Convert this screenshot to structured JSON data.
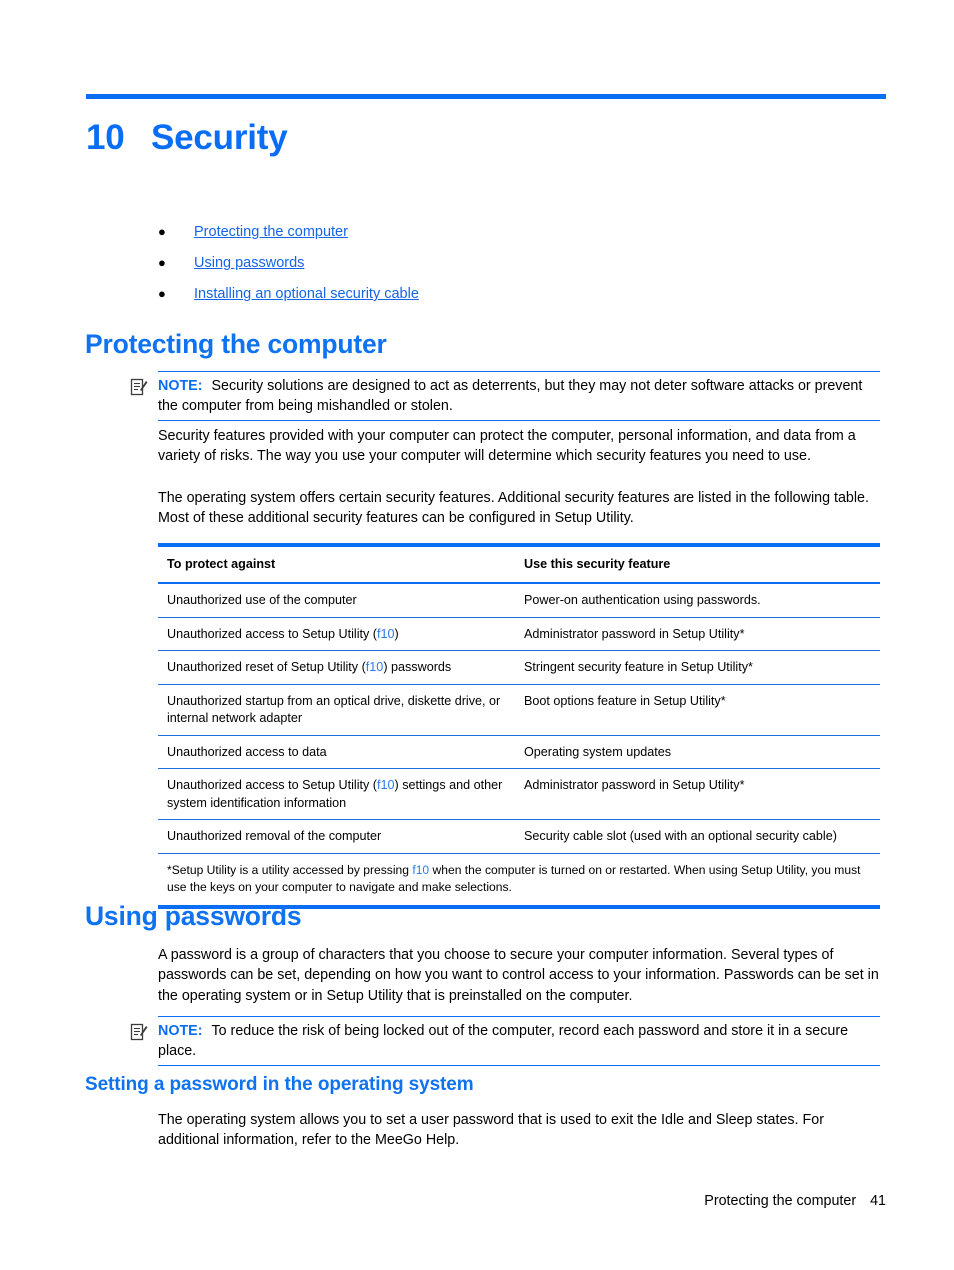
{
  "chapter": {
    "number": "10",
    "title": "Security"
  },
  "toc": {
    "items": [
      {
        "label": "Protecting the computer"
      },
      {
        "label": "Using passwords"
      },
      {
        "label": "Installing an optional security cable"
      }
    ]
  },
  "sections": {
    "protecting": {
      "heading": "Protecting the computer",
      "note": {
        "label": "NOTE:",
        "text": "Security solutions are designed to act as deterrents, but they may not deter software attacks or prevent the computer from being mishandled or stolen."
      },
      "paragraph1": "Security features provided with your computer can protect the computer, personal information, and data from a variety of risks. The way you use your computer will determine which security features you need to use.",
      "paragraph2": "The operating system offers certain security features. Additional security features are listed in the following table. Most of these additional security features can be configured in Setup Utility."
    },
    "passwords": {
      "heading": "Using passwords",
      "paragraph1": "A password is a group of characters that you choose to secure your computer information. Several types of passwords can be set, depending on how you want to control access to your information. Passwords can be set in the operating system or in Setup Utility that is preinstalled on the computer.",
      "note": {
        "label": "NOTE:",
        "text": "To reduce the risk of being locked out of the computer, record each password and store it in a secure place."
      }
    },
    "setting_password": {
      "heading": "Setting a password in the operating system",
      "paragraph1": "The operating system allows you to set a user password that is used to exit the Idle and Sleep states. For additional information, refer to the MeeGo Help."
    }
  },
  "table": {
    "headers": {
      "col_a": "To protect against",
      "col_b": "Use this security feature"
    },
    "rows": [
      {
        "a_pre": "Unauthorized use of the computer",
        "a_key": "",
        "a_post": "",
        "b": "Power-on authentication using passwords."
      },
      {
        "a_pre": "Unauthorized access to Setup Utility (",
        "a_key": "f10",
        "a_post": ")",
        "b": "Administrator password in Setup Utility*"
      },
      {
        "a_pre": "Unauthorized reset of Setup Utility (",
        "a_key": "f10",
        "a_post": ") passwords",
        "b": "Stringent security feature in Setup Utility*"
      },
      {
        "a_pre": "Unauthorized startup from an optical drive, diskette drive, or internal network adapter",
        "a_key": "",
        "a_post": "",
        "b": "Boot options feature in Setup Utility*"
      },
      {
        "a_pre": "Unauthorized access to data",
        "a_key": "",
        "a_post": "",
        "b": "Operating system updates"
      },
      {
        "a_pre": "Unauthorized access to Setup Utility (",
        "a_key": "f10",
        "a_post": ") settings and other system identification information",
        "b": "Administrator password in Setup Utility*"
      },
      {
        "a_pre": "Unauthorized removal of the computer",
        "a_key": "",
        "a_post": "",
        "b": "Security cable slot (used with an optional security cable)"
      }
    ],
    "footnote_pre": "*Setup Utility is a utility accessed by pressing ",
    "footnote_key": "f10",
    "footnote_post": " when the computer is turned on or restarted. When using Setup Utility, you must use the keys on your computer to navigate and make selections."
  },
  "footer": {
    "section": "Protecting the computer",
    "page_number": "41"
  },
  "colors": {
    "accent_blue": "#0a6ef5",
    "link_blue": "#1565e8",
    "key_blue": "#2a7bea"
  }
}
